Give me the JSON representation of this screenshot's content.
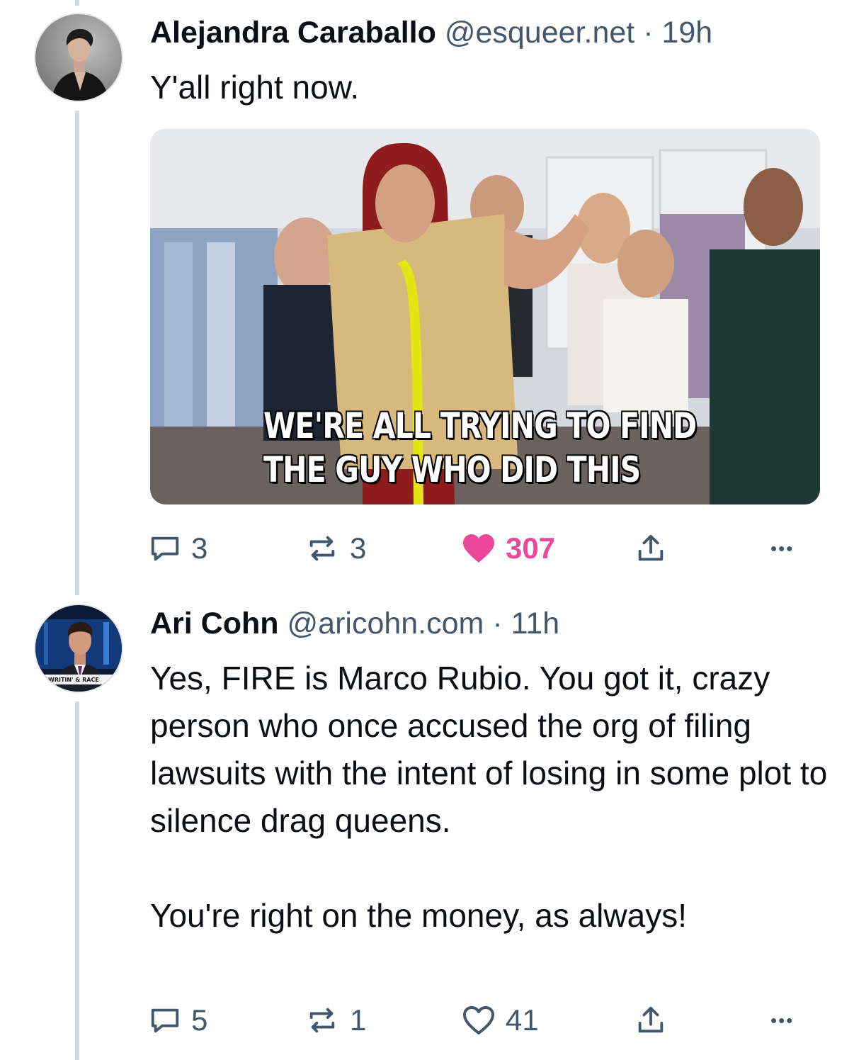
{
  "posts": [
    {
      "author": "Alejandra Caraballo",
      "handle": "@esqueer.net",
      "separator": "·",
      "time": "19h",
      "text": "Y'all right now.",
      "media": {
        "caption_line1": "WE'RE ALL TRYING TO FIND",
        "caption_line2": "THE GUY WHO DID THIS"
      },
      "replies": "3",
      "reposts": "3",
      "likes": "307",
      "liked": true,
      "more": "•••"
    },
    {
      "author": "Ari Cohn",
      "handle": "@aricohn.com",
      "separator": "·",
      "time": "11h",
      "text": "Yes, FIRE is Marco Rubio. You got it, crazy person who once accused the org of filing lawsuits with the intent of losing in some plot to silence drag queens.\n\nYou're right on the money, as always!",
      "avatar_badge": "WRITIN' & RACE",
      "replies": "5",
      "reposts": "1",
      "likes": "41",
      "liked": false,
      "more": "•••"
    }
  ],
  "colors": {
    "muted": "#42576c",
    "like": "#ec4899",
    "thread_line": "#d4dbe2"
  }
}
